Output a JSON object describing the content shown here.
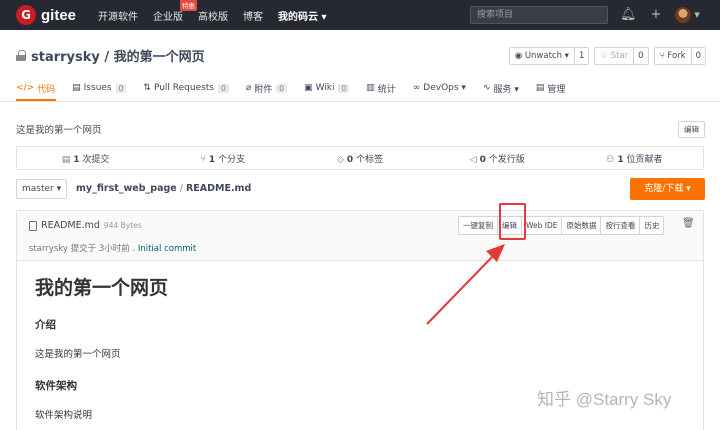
{
  "topnav": {
    "logo_mark": "G",
    "logo_text": "gitee",
    "links": [
      {
        "label": "开源软件"
      },
      {
        "label": "企业版",
        "badge": "特惠"
      },
      {
        "label": "高校版"
      },
      {
        "label": "博客"
      },
      {
        "label": "我的码云 ▾"
      }
    ],
    "search_placeholder": "搜索项目",
    "icons": [
      "bell-icon",
      "plus-icon",
      "avatar"
    ]
  },
  "repo": {
    "title": "starrysky / 我的第一个网页",
    "actions": [
      {
        "label": "◉ Unwatch ▾",
        "count": "1"
      },
      {
        "label": "☆ Star",
        "count": "0"
      },
      {
        "label": "⑂ Fork",
        "count": "0"
      }
    ]
  },
  "tabs": [
    {
      "icon": "</>",
      "label": "代码",
      "count": null,
      "active": true
    },
    {
      "icon": "▤",
      "label": "Issues",
      "count": "0"
    },
    {
      "icon": "⇅",
      "label": "Pull Requests",
      "count": "0"
    },
    {
      "icon": "⌀",
      "label": "附件",
      "count": "0"
    },
    {
      "icon": "▣",
      "label": "Wiki",
      "count": "0"
    },
    {
      "icon": "▥",
      "label": "统计",
      "count": null
    },
    {
      "icon": "∞",
      "label": "DevOps ▾",
      "count": null
    },
    {
      "icon": "∿",
      "label": "服务 ▾",
      "count": null
    },
    {
      "icon": "▤",
      "label": "管理",
      "count": null
    }
  ],
  "description": "这是我的第一个网页",
  "edit_small_label": "编辑",
  "stats": [
    {
      "icon": "▤",
      "count": "1",
      "label": "次提交"
    },
    {
      "icon": "⑂",
      "count": "1",
      "label": "个分支"
    },
    {
      "icon": "◇",
      "count": "0",
      "label": "个标签"
    },
    {
      "icon": "◁",
      "count": "0",
      "label": "个发行版"
    },
    {
      "icon": "⚇",
      "count": "1",
      "label": "位贡献者"
    }
  ],
  "branch": "master ▾",
  "breadcrumb": {
    "repo": "my_first_web_page",
    "sep": "/",
    "file": "README.md"
  },
  "clone_label": "克隆/下载 ▾",
  "file": {
    "name": "README.md",
    "size": "944 Bytes",
    "commit_author": "starrysky 提交于 3小时前 .",
    "commit_msg": "Initial commit",
    "buttons": [
      "一键复制",
      "编辑",
      "Web IDE",
      "原始数据",
      "按行查看",
      "历史"
    ]
  },
  "readme": {
    "h1": "我的第一个网页",
    "sections": [
      {
        "heading": "介绍",
        "text": "这是我的第一个网页"
      },
      {
        "heading": "软件架构",
        "text": "软件架构说明"
      }
    ]
  },
  "watermark": "知乎 @Starry Sky",
  "colors": {
    "accent": "#fe7300",
    "nav_bg": "#262932",
    "annotation": "#e53935",
    "brand": "#c71d23"
  }
}
